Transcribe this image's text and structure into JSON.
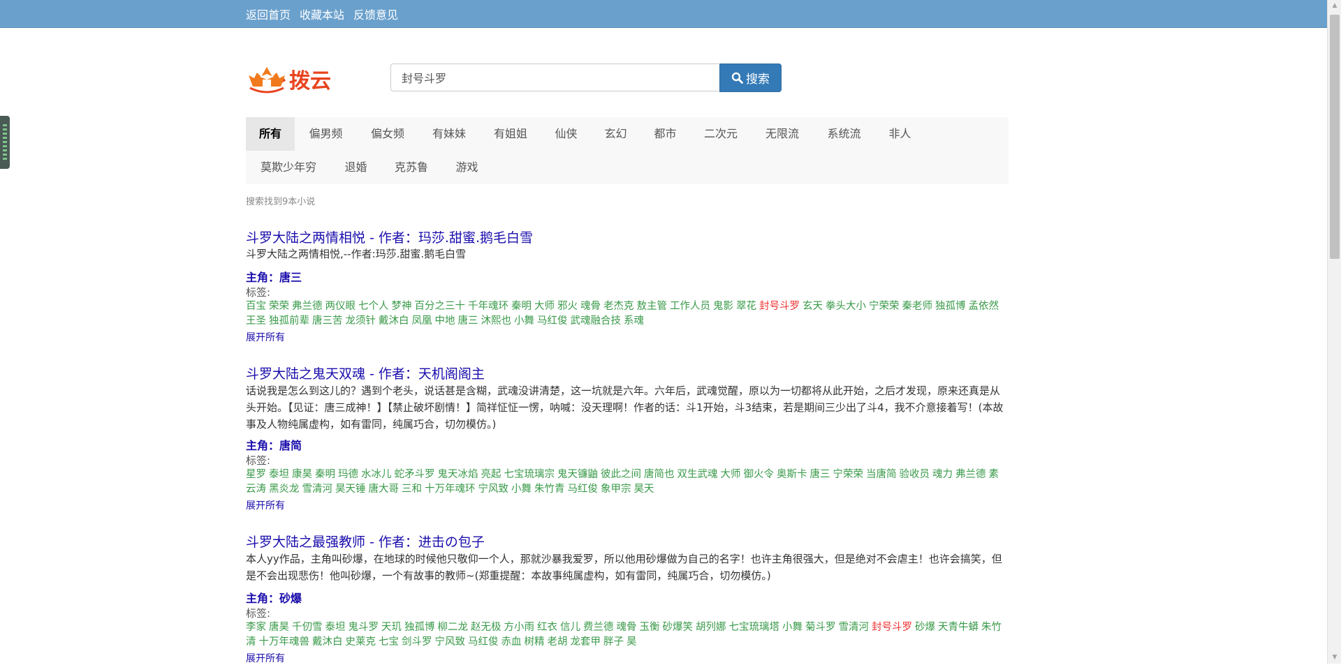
{
  "topnav": [
    "返回首页",
    "收藏本站",
    "反馈意见"
  ],
  "logo_text": "拨云",
  "search": {
    "value": "封号斗罗",
    "button_label": "搜索"
  },
  "categories": [
    "所有",
    "偏男频",
    "偏女频",
    "有妹妹",
    "有姐姐",
    "仙侠",
    "玄幻",
    "都市",
    "二次元",
    "无限流",
    "系统流",
    "非人",
    "莫欺少年穷",
    "退婚",
    "克苏鲁",
    "游戏"
  ],
  "result_count": "搜索找到9本小说",
  "tags_label": "标签:",
  "role_prefix": "主角：",
  "expand_label": "展开所有",
  "results": [
    {
      "title": "斗罗大陆之两情相悦 - 作者：玛莎.甜蜜.鹅毛白雪",
      "desc": "斗罗大陆之两情相悦,--作者:玛莎.甜蜜.鹅毛白雪",
      "role": "唐三",
      "tags": [
        "百宝",
        "荣荣",
        "弗兰德",
        "两仪眼",
        "七个人",
        "梦神",
        "百分之三十",
        "千年魂环",
        "秦明",
        "大师",
        "邪火",
        "魂骨",
        "老杰克",
        "敖主管",
        "工作人员",
        "鬼影",
        "翠花",
        "封号斗罗",
        "玄天",
        "拳头大小",
        "宁荣荣",
        "秦老师",
        "独孤博",
        "孟依然",
        "王圣",
        "独孤前辈",
        "唐三苦",
        "龙须针",
        "戴沐白",
        "凤凰",
        "中地",
        "唐三",
        "沐熙也",
        "小舞",
        "马红俊",
        "武魂融合技",
        "系魂"
      ]
    },
    {
      "title": "斗罗大陆之鬼天双魂 - 作者：天机阁阁主",
      "desc": "话说我是怎么到这儿的？遇到个老头，说话甚是含糊，武魂没讲清楚，这一坑就是六年。六年后，武魂觉醒，原以为一切都将从此开始，之后才发现，原来还真是从头开始。【见证：唐三成神！】【禁止破坏剧情！】简祥怔怔一愣，呐喊：没天理啊！作者的话：斗1开始，斗3结束，若是期间三少出了斗4，我不介意接着写！(本故事及人物纯属虚构，如有雷同，纯属巧合，切勿模仿。)",
      "role": "唐简",
      "tags": [
        "星罗",
        "泰坦",
        "康昊",
        "秦明",
        "玛德",
        "水冰儿",
        "蛇矛斗罗",
        "鬼天冰焰",
        "亮起",
        "七宝琉璃宗",
        "鬼天镰鼬",
        "彼此之间",
        "唐简也",
        "双生武魂",
        "大师",
        "御火令",
        "奥斯卡",
        "唐三",
        "宁荣荣",
        "当唐简",
        "验收员",
        "魂力",
        "弗兰德",
        "素云涛",
        "黑炎龙",
        "雪清河",
        "昊天锤",
        "唐大哥",
        "三和",
        "十万年魂环",
        "宁风致",
        "小舞",
        "朱竹青",
        "马红俊",
        "象甲宗",
        "昊天"
      ]
    },
    {
      "title": "斗罗大陆之最强教师 - 作者：进击の包子",
      "desc": "本人yy作品，主角叫砂爆，在地球的时候他只敬仰一个人，那就沙暴我爱罗，所以他用砂爆做为自己的名字！也许主角很强大，但是绝对不会虐主！也许会搞笑，但是不会出现悲伤！他叫砂爆，一个有故事的教师~(郑重提醒：本故事纯属虚构，如有雷同，纯属巧合，切勿模仿。)",
      "role": "砂爆",
      "tags": [
        "李家",
        "唐昊",
        "千仞雪",
        "泰坦",
        "鬼斗罗",
        "天玑",
        "独孤博",
        "柳二龙",
        "赵无极",
        "方小雨",
        "红衣",
        "信儿",
        "费兰德",
        "魂骨",
        "玉衡",
        "砂爆笑",
        "胡列娜",
        "七宝琉璃塔",
        "小舞",
        "菊斗罗",
        "雪清河",
        "封号斗罗",
        "砂爆",
        "天青牛蟒",
        "朱竹清",
        "十万年魂兽",
        "戴沐白",
        "史莱克",
        "七宝",
        "剑斗罗",
        "宁风致",
        "马红俊",
        "赤血",
        "树精",
        "老胡",
        "龙套甲",
        "胖子",
        "昊"
      ]
    }
  ],
  "highlight_tag": "封号斗罗"
}
